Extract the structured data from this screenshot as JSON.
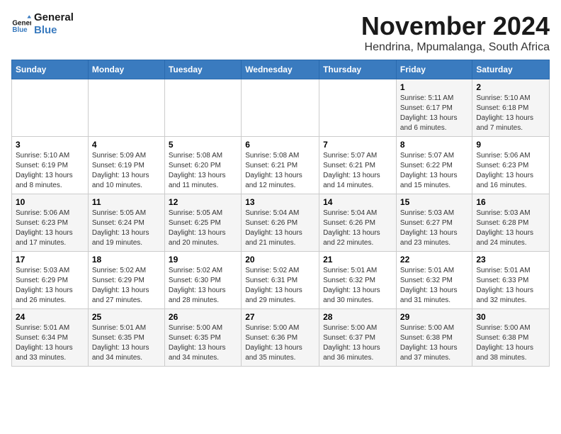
{
  "logo": {
    "line1": "General",
    "line2": "Blue"
  },
  "title": "November 2024",
  "subtitle": "Hendrina, Mpumalanga, South Africa",
  "header": {
    "days": [
      "Sunday",
      "Monday",
      "Tuesday",
      "Wednesday",
      "Thursday",
      "Friday",
      "Saturday"
    ]
  },
  "weeks": [
    [
      {
        "day": "",
        "info": ""
      },
      {
        "day": "",
        "info": ""
      },
      {
        "day": "",
        "info": ""
      },
      {
        "day": "",
        "info": ""
      },
      {
        "day": "",
        "info": ""
      },
      {
        "day": "1",
        "info": "Sunrise: 5:11 AM\nSunset: 6:17 PM\nDaylight: 13 hours and 6 minutes."
      },
      {
        "day": "2",
        "info": "Sunrise: 5:10 AM\nSunset: 6:18 PM\nDaylight: 13 hours and 7 minutes."
      }
    ],
    [
      {
        "day": "3",
        "info": "Sunrise: 5:10 AM\nSunset: 6:19 PM\nDaylight: 13 hours and 8 minutes."
      },
      {
        "day": "4",
        "info": "Sunrise: 5:09 AM\nSunset: 6:19 PM\nDaylight: 13 hours and 10 minutes."
      },
      {
        "day": "5",
        "info": "Sunrise: 5:08 AM\nSunset: 6:20 PM\nDaylight: 13 hours and 11 minutes."
      },
      {
        "day": "6",
        "info": "Sunrise: 5:08 AM\nSunset: 6:21 PM\nDaylight: 13 hours and 12 minutes."
      },
      {
        "day": "7",
        "info": "Sunrise: 5:07 AM\nSunset: 6:21 PM\nDaylight: 13 hours and 14 minutes."
      },
      {
        "day": "8",
        "info": "Sunrise: 5:07 AM\nSunset: 6:22 PM\nDaylight: 13 hours and 15 minutes."
      },
      {
        "day": "9",
        "info": "Sunrise: 5:06 AM\nSunset: 6:23 PM\nDaylight: 13 hours and 16 minutes."
      }
    ],
    [
      {
        "day": "10",
        "info": "Sunrise: 5:06 AM\nSunset: 6:23 PM\nDaylight: 13 hours and 17 minutes."
      },
      {
        "day": "11",
        "info": "Sunrise: 5:05 AM\nSunset: 6:24 PM\nDaylight: 13 hours and 19 minutes."
      },
      {
        "day": "12",
        "info": "Sunrise: 5:05 AM\nSunset: 6:25 PM\nDaylight: 13 hours and 20 minutes."
      },
      {
        "day": "13",
        "info": "Sunrise: 5:04 AM\nSunset: 6:26 PM\nDaylight: 13 hours and 21 minutes."
      },
      {
        "day": "14",
        "info": "Sunrise: 5:04 AM\nSunset: 6:26 PM\nDaylight: 13 hours and 22 minutes."
      },
      {
        "day": "15",
        "info": "Sunrise: 5:03 AM\nSunset: 6:27 PM\nDaylight: 13 hours and 23 minutes."
      },
      {
        "day": "16",
        "info": "Sunrise: 5:03 AM\nSunset: 6:28 PM\nDaylight: 13 hours and 24 minutes."
      }
    ],
    [
      {
        "day": "17",
        "info": "Sunrise: 5:03 AM\nSunset: 6:29 PM\nDaylight: 13 hours and 26 minutes."
      },
      {
        "day": "18",
        "info": "Sunrise: 5:02 AM\nSunset: 6:29 PM\nDaylight: 13 hours and 27 minutes."
      },
      {
        "day": "19",
        "info": "Sunrise: 5:02 AM\nSunset: 6:30 PM\nDaylight: 13 hours and 28 minutes."
      },
      {
        "day": "20",
        "info": "Sunrise: 5:02 AM\nSunset: 6:31 PM\nDaylight: 13 hours and 29 minutes."
      },
      {
        "day": "21",
        "info": "Sunrise: 5:01 AM\nSunset: 6:32 PM\nDaylight: 13 hours and 30 minutes."
      },
      {
        "day": "22",
        "info": "Sunrise: 5:01 AM\nSunset: 6:32 PM\nDaylight: 13 hours and 31 minutes."
      },
      {
        "day": "23",
        "info": "Sunrise: 5:01 AM\nSunset: 6:33 PM\nDaylight: 13 hours and 32 minutes."
      }
    ],
    [
      {
        "day": "24",
        "info": "Sunrise: 5:01 AM\nSunset: 6:34 PM\nDaylight: 13 hours and 33 minutes."
      },
      {
        "day": "25",
        "info": "Sunrise: 5:01 AM\nSunset: 6:35 PM\nDaylight: 13 hours and 34 minutes."
      },
      {
        "day": "26",
        "info": "Sunrise: 5:00 AM\nSunset: 6:35 PM\nDaylight: 13 hours and 34 minutes."
      },
      {
        "day": "27",
        "info": "Sunrise: 5:00 AM\nSunset: 6:36 PM\nDaylight: 13 hours and 35 minutes."
      },
      {
        "day": "28",
        "info": "Sunrise: 5:00 AM\nSunset: 6:37 PM\nDaylight: 13 hours and 36 minutes."
      },
      {
        "day": "29",
        "info": "Sunrise: 5:00 AM\nSunset: 6:38 PM\nDaylight: 13 hours and 37 minutes."
      },
      {
        "day": "30",
        "info": "Sunrise: 5:00 AM\nSunset: 6:38 PM\nDaylight: 13 hours and 38 minutes."
      }
    ]
  ]
}
